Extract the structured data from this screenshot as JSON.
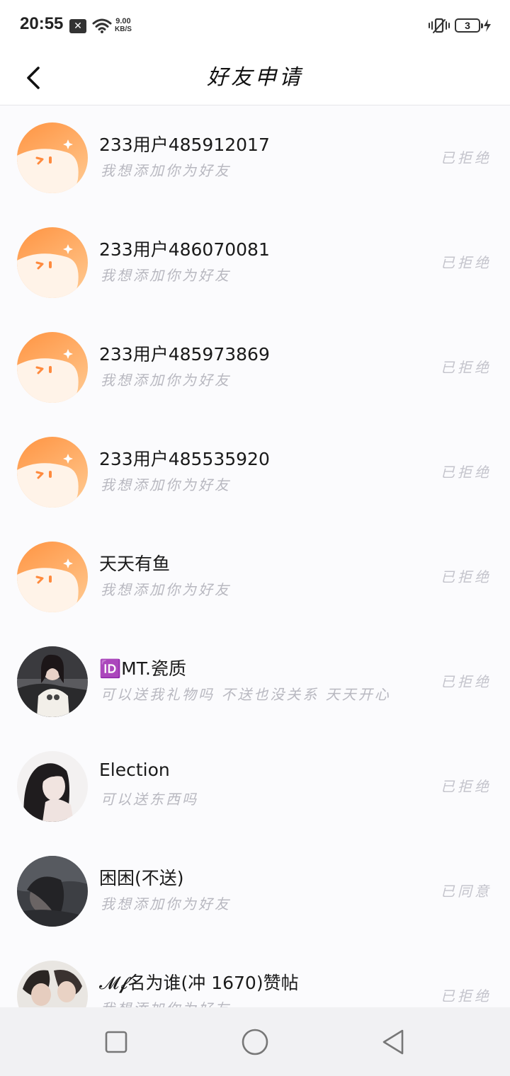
{
  "status_bar": {
    "time": "20:55",
    "notif_glyph": "✕",
    "speed_value": "9.00",
    "speed_unit": "KB/S",
    "battery": "3"
  },
  "header": {
    "back_icon": "chevron-left-icon",
    "title": "好友申请"
  },
  "requests": [
    {
      "name": "233用户485912017",
      "message": "我想添加你为好友",
      "status": "已拒绝",
      "avatar": "default-orange"
    },
    {
      "name": "233用户486070081",
      "message": "我想添加你为好友",
      "status": "已拒绝",
      "avatar": "default-orange"
    },
    {
      "name": "233用户485973869",
      "message": "我想添加你为好友",
      "status": "已拒绝",
      "avatar": "default-orange"
    },
    {
      "name": "233用户485535920",
      "message": "我想添加你为好友",
      "status": "已拒绝",
      "avatar": "default-orange"
    },
    {
      "name": "天天有鱼",
      "message": "我想添加你为好友",
      "status": "已拒绝",
      "avatar": "default-orange"
    },
    {
      "name": "🆔MT.瓷质",
      "message": "可以送我礼物吗 不送也没关系 天天开心",
      "status": "已拒绝",
      "avatar": "photo"
    },
    {
      "name": "Election",
      "message": "可以送东西吗",
      "status": "已拒绝",
      "avatar": "photo"
    },
    {
      "name": "困困(不送)",
      "message": "我想添加你为好友",
      "status": "已同意",
      "avatar": "photo"
    },
    {
      "name": "𝓜𝓯名为谁(冲 1670)赞帖",
      "message": "我想添加你为好友",
      "status": "已拒绝",
      "avatar": "photo"
    }
  ],
  "nav_bar": {
    "recents_icon": "square-icon",
    "home_icon": "circle-icon",
    "back_icon": "triangle-back-icon"
  },
  "colors": {
    "avatar_orange": "#ff9f55",
    "muted_text": "#b8b8c0",
    "nav_bg": "#f1f1f3"
  }
}
